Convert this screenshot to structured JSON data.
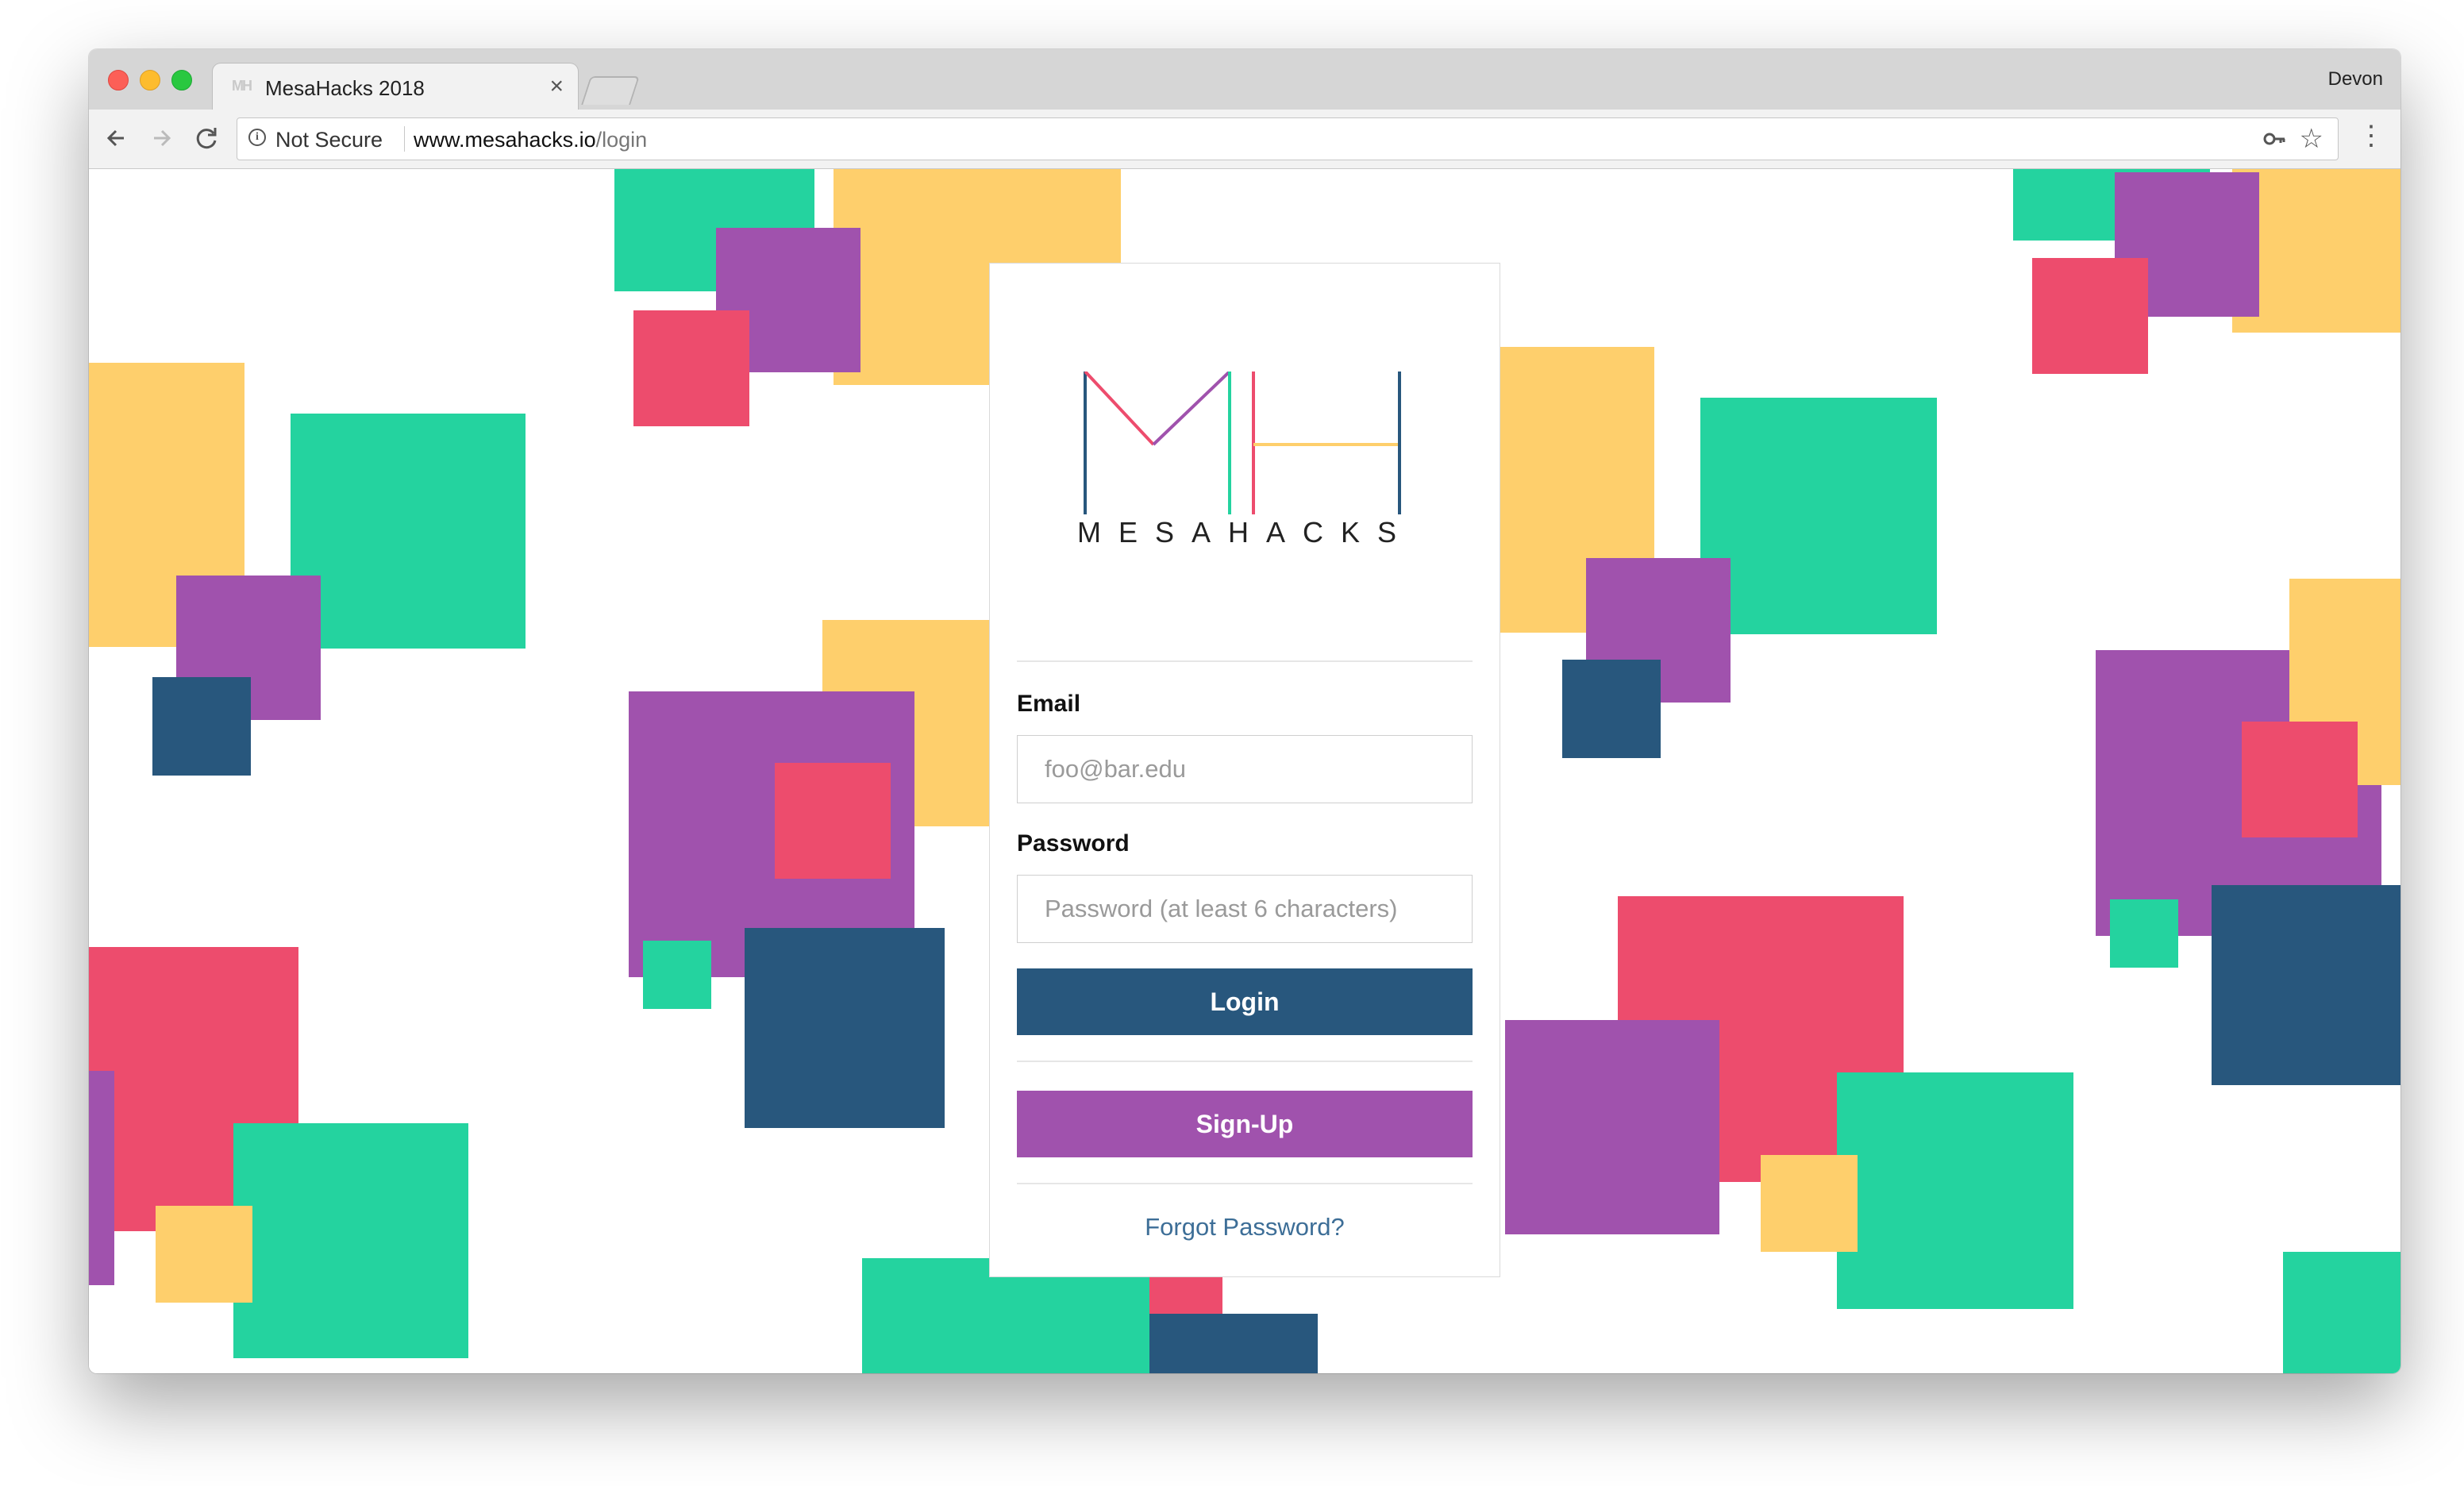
{
  "browser": {
    "tab_title": "MesaHacks 2018",
    "tab_close": "×",
    "favicon_text": "MH",
    "profile_name": "Devon",
    "security_label": "Not Secure",
    "url_host": "www.mesahacks.io",
    "url_path": "/login",
    "icons": {
      "back": "back-arrow-icon",
      "forward": "forward-arrow-icon",
      "reload": "reload-icon",
      "info": "info-icon",
      "key": "key-icon",
      "star": "star-icon",
      "menu": "menu-icon"
    }
  },
  "brand": {
    "wordmark": "MESAHACKS",
    "colors": {
      "green": "#24d39f",
      "yellow": "#fecf6c",
      "purple": "#a052ad",
      "red": "#ed4c6d",
      "navy": "#28577d"
    }
  },
  "login_form": {
    "email_label": "Email",
    "email_placeholder": "foo@bar.edu",
    "password_label": "Password",
    "password_placeholder": "Password (at least 6 characters)",
    "login_button": "Login",
    "signup_button": "Sign-Up",
    "forgot_link": "Forgot Password?"
  }
}
